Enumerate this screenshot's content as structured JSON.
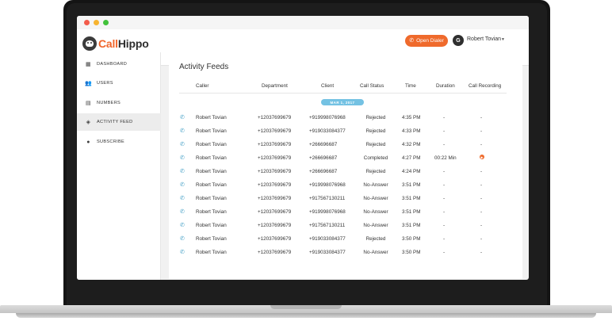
{
  "app": {
    "logo_prefix": "Call",
    "logo_suffix": "Hippo"
  },
  "header": {
    "dialer_label": "Open Dialer",
    "avatar_letter": "G",
    "user_name": "Robert Tovian"
  },
  "sidebar": {
    "items": [
      {
        "label": "DASHBOARD",
        "icon": "grid-icon",
        "active": false
      },
      {
        "label": "USERS",
        "icon": "users-icon",
        "active": false
      },
      {
        "label": "NUMBERS",
        "icon": "numbers-icon",
        "active": false
      },
      {
        "label": "ACTIVITY FEED",
        "icon": "activity-icon",
        "active": true
      },
      {
        "label": "SUBSCRIBE",
        "icon": "subscribe-icon",
        "active": false
      }
    ]
  },
  "main": {
    "title": "Activity Feeds",
    "columns": [
      "Caller",
      "Department",
      "Client",
      "Call Status",
      "Time",
      "Duration",
      "Call Recording"
    ],
    "date_label": "MAR 1, 2017",
    "rows": [
      {
        "caller": "Robert Tovian",
        "department": "+12037699679",
        "client": "+919998076968",
        "status": "Rejected",
        "time": "4:35 PM",
        "duration": "-",
        "recording": "-"
      },
      {
        "caller": "Robert Tovian",
        "department": "+12037699679",
        "client": "+919033084377",
        "status": "Rejected",
        "time": "4:33 PM",
        "duration": "-",
        "recording": "-"
      },
      {
        "caller": "Robert Tovian",
        "department": "+12037699679",
        "client": "+266696687",
        "status": "Rejected",
        "time": "4:32 PM",
        "duration": "-",
        "recording": "-"
      },
      {
        "caller": "Robert Tovian",
        "department": "+12037699679",
        "client": "+266696687",
        "status": "Completed",
        "time": "4:27 PM",
        "duration": "00:22 Min",
        "recording": ""
      },
      {
        "caller": "Robert Tovian",
        "department": "+12037699679",
        "client": "+266696687",
        "status": "Rejected",
        "time": "4:24 PM",
        "duration": "-",
        "recording": "-"
      },
      {
        "caller": "Robert Tovian",
        "department": "+12037699679",
        "client": "+919998076968",
        "status": "No-Answer",
        "time": "3:51 PM",
        "duration": "-",
        "recording": "-"
      },
      {
        "caller": "Robert Tovian",
        "department": "+12037699679",
        "client": "+917567130211",
        "status": "No-Answer",
        "time": "3:51 PM",
        "duration": "-",
        "recording": "-"
      },
      {
        "caller": "Robert Tovian",
        "department": "+12037699679",
        "client": "+919998076968",
        "status": "No-Answer",
        "time": "3:51 PM",
        "duration": "-",
        "recording": "-"
      },
      {
        "caller": "Robert Tovian",
        "department": "+12037699679",
        "client": "+917567130211",
        "status": "No-Answer",
        "time": "3:51 PM",
        "duration": "-",
        "recording": "-"
      },
      {
        "caller": "Robert Tovian",
        "department": "+12037699679",
        "client": "+919033084377",
        "status": "Rejected",
        "time": "3:50 PM",
        "duration": "-",
        "recording": "-"
      },
      {
        "caller": "Robert Tovian",
        "department": "+12037699679",
        "client": "+919033084377",
        "status": "No-Answer",
        "time": "3:50 PM",
        "duration": "-",
        "recording": "-"
      }
    ]
  },
  "colors": {
    "accent": "#ef6a2c",
    "date_pill": "#74c2e3",
    "call_icon": "#4aa3c8"
  }
}
